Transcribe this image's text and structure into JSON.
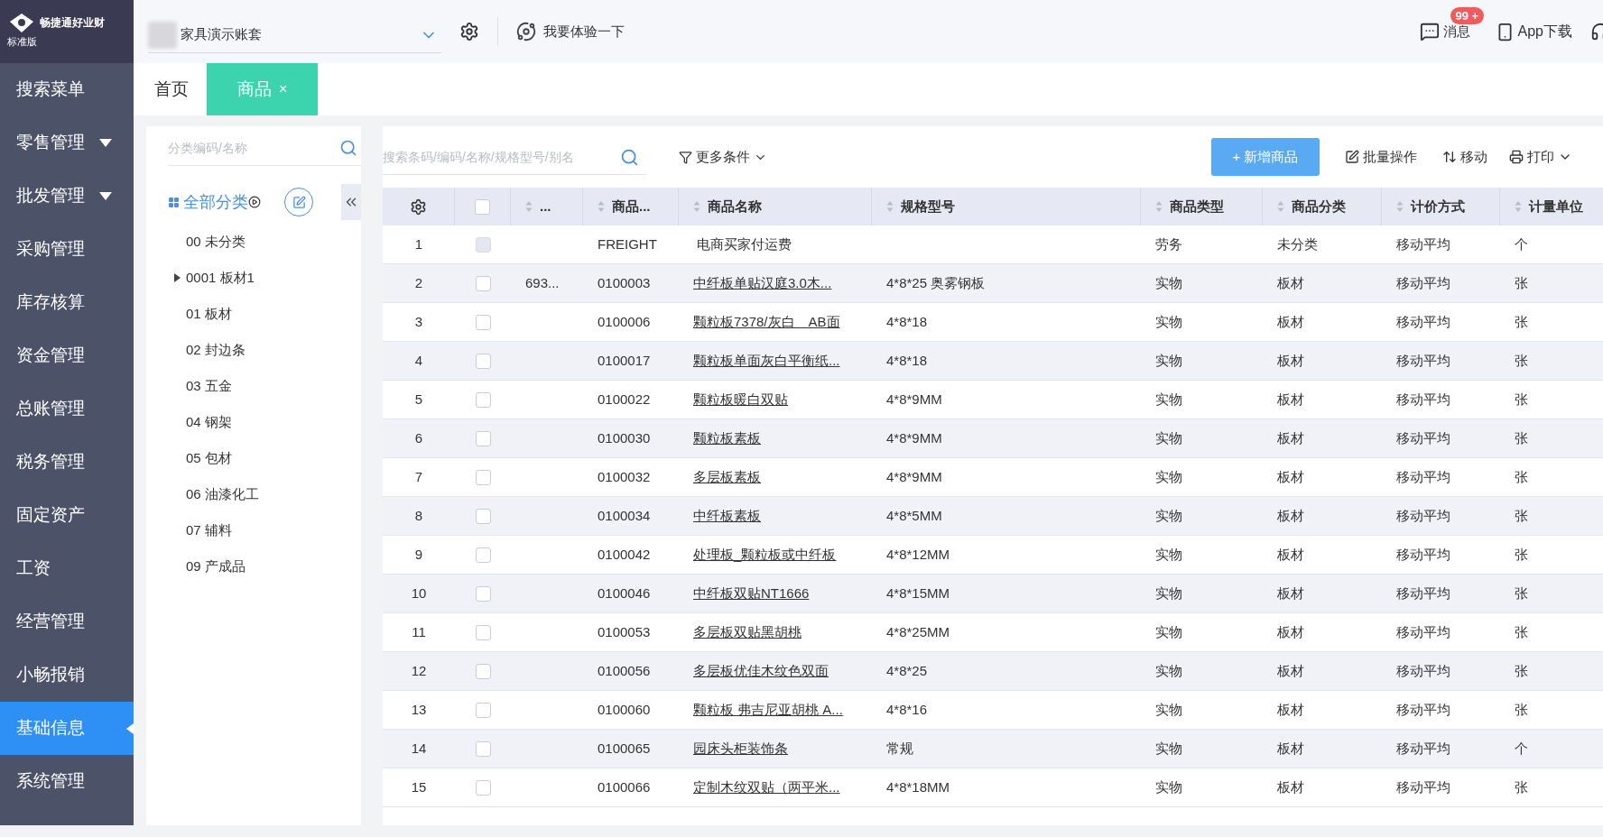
{
  "brand": {
    "name": "畅捷通好业财",
    "edition": "标准版"
  },
  "header": {
    "account": "家具演示账套",
    "try_link": "我要体验一下",
    "messages": {
      "label": "消息",
      "badge": "99 +"
    },
    "app_download": "App下载"
  },
  "sidebar": {
    "items": [
      {
        "label": "搜索菜单",
        "expandable": false,
        "selected": false
      },
      {
        "label": "零售管理",
        "expandable": true,
        "selected": false
      },
      {
        "label": "批发管理",
        "expandable": true,
        "selected": false
      },
      {
        "label": "采购管理",
        "expandable": false,
        "selected": false
      },
      {
        "label": "库存核算",
        "expandable": false,
        "selected": false
      },
      {
        "label": "资金管理",
        "expandable": false,
        "selected": false
      },
      {
        "label": "总账管理",
        "expandable": false,
        "selected": false
      },
      {
        "label": "税务管理",
        "expandable": false,
        "selected": false
      },
      {
        "label": "固定资产",
        "expandable": false,
        "selected": false
      },
      {
        "label": "工资",
        "expandable": false,
        "selected": false
      },
      {
        "label": "经营管理",
        "expandable": false,
        "selected": false
      },
      {
        "label": "小畅报销",
        "expandable": false,
        "selected": false
      },
      {
        "label": "基础信息",
        "expandable": false,
        "selected": true
      },
      {
        "label": "系统管理",
        "expandable": false,
        "selected": false
      }
    ]
  },
  "tabs": [
    {
      "label": "首页",
      "selected": false
    },
    {
      "label": "商品",
      "selected": true,
      "close": "×"
    }
  ],
  "category_panel": {
    "search_placeholder": "分类编码/名称",
    "root": "全部分类",
    "items": [
      {
        "label": "00 未分类",
        "expandable": false
      },
      {
        "label": "0001 板材1",
        "expandable": true
      },
      {
        "label": "01 板材",
        "expandable": false
      },
      {
        "label": "02 封边条",
        "expandable": false
      },
      {
        "label": "03 五金",
        "expandable": false
      },
      {
        "label": "04 钢架",
        "expandable": false
      },
      {
        "label": "05 包材",
        "expandable": false
      },
      {
        "label": "06 油漆化工",
        "expandable": false
      },
      {
        "label": "07 辅料",
        "expandable": false
      },
      {
        "label": "09 产成品",
        "expandable": false
      }
    ]
  },
  "toolbar": {
    "search_placeholder": "搜索条码/编码/名称/规格型号/别名",
    "more_filters": "更多条件",
    "add_button": "+ 新增商品",
    "batch": "批量操作",
    "move": "移动",
    "print": "打印"
  },
  "table": {
    "columns": [
      "...",
      "商品...",
      "商品名称",
      "规格型号",
      "商品类型",
      "商品分类",
      "计价方式",
      "计量单位"
    ],
    "select_all": {
      "checked": false
    },
    "rows": [
      {
        "no": "1",
        "checked": false,
        "disabled": true,
        "code": "FREIGHT",
        "name": "电商买家付运费",
        "link": false,
        "type": "劳务",
        "category": "未分类",
        "pricing": "移动平均",
        "unit": "个"
      },
      {
        "no": "2",
        "checked": false,
        "disabled": false,
        "barcode": "693...",
        "code": "0100003",
        "name": "中纤板单贴汉庭3.0木...",
        "link": true,
        "spec": "4*8*25 奥雾钢板",
        "type": "实物",
        "category": "板材",
        "pricing": "移动平均",
        "unit": "张"
      },
      {
        "no": "3",
        "checked": false,
        "disabled": false,
        "code": "0100006",
        "name": "颗粒板7378/灰白　AB面",
        "link": true,
        "spec": "4*8*18",
        "type": "实物",
        "category": "板材",
        "pricing": "移动平均",
        "unit": "张"
      },
      {
        "no": "4",
        "checked": false,
        "disabled": false,
        "code": "0100017",
        "name": "颗粒板单面灰白平衡纸...",
        "link": true,
        "spec": "4*8*18",
        "type": "实物",
        "category": "板材",
        "pricing": "移动平均",
        "unit": "张"
      },
      {
        "no": "5",
        "checked": false,
        "disabled": false,
        "code": "0100022",
        "name": "颗粒板暖白双贴",
        "link": true,
        "spec": "4*8*9MM",
        "type": "实物",
        "category": "板材",
        "pricing": "移动平均",
        "unit": "张"
      },
      {
        "no": "6",
        "checked": false,
        "disabled": false,
        "code": "0100030",
        "name": "颗粒板素板",
        "link": true,
        "spec": "4*8*9MM",
        "type": "实物",
        "category": "板材",
        "pricing": "移动平均",
        "unit": "张"
      },
      {
        "no": "7",
        "checked": false,
        "disabled": false,
        "code": "0100032",
        "name": "多层板素板",
        "link": true,
        "spec": "4*8*9MM",
        "type": "实物",
        "category": "板材",
        "pricing": "移动平均",
        "unit": "张"
      },
      {
        "no": "8",
        "checked": false,
        "disabled": false,
        "code": "0100034",
        "name": "中纤板素板",
        "link": true,
        "spec": "4*8*5MM",
        "type": "实物",
        "category": "板材",
        "pricing": "移动平均",
        "unit": "张"
      },
      {
        "no": "9",
        "checked": false,
        "disabled": false,
        "code": "0100042",
        "name": "处理板_颗粒板或中纤板",
        "link": true,
        "spec": "4*8*12MM",
        "type": "实物",
        "category": "板材",
        "pricing": "移动平均",
        "unit": "张"
      },
      {
        "no": "10",
        "checked": false,
        "disabled": false,
        "code": "0100046",
        "name": "中纤板双贴NT1666",
        "link": true,
        "spec": "4*8*15MM",
        "type": "实物",
        "category": "板材",
        "pricing": "移动平均",
        "unit": "张"
      },
      {
        "no": "11",
        "checked": false,
        "disabled": false,
        "code": "0100053",
        "name": "多层板双贴黑胡桃",
        "link": true,
        "spec": "4*8*25MM",
        "type": "实物",
        "category": "板材",
        "pricing": "移动平均",
        "unit": "张"
      },
      {
        "no": "12",
        "checked": false,
        "disabled": false,
        "code": "0100056",
        "name": "多层板优佳木纹色双面",
        "link": true,
        "spec": "4*8*25",
        "type": "实物",
        "category": "板材",
        "pricing": "移动平均",
        "unit": "张"
      },
      {
        "no": "13",
        "checked": false,
        "disabled": false,
        "code": "0100060",
        "name": "颗粒板 弗吉尼亚胡桃 A...",
        "link": true,
        "spec": "4*8*16",
        "type": "实物",
        "category": "板材",
        "pricing": "移动平均",
        "unit": "张"
      },
      {
        "no": "14",
        "checked": false,
        "disabled": false,
        "code": "0100065",
        "name": "园床头柜装饰条",
        "link": true,
        "spec": "常规",
        "type": "实物",
        "category": "板材",
        "pricing": "移动平均",
        "unit": "个"
      },
      {
        "no": "15",
        "checked": false,
        "disabled": false,
        "code": "0100066",
        "name": "定制木纹双贴（两平米...",
        "link": true,
        "spec": "4*8*18MM",
        "type": "实物",
        "category": "板材",
        "pricing": "移动平均",
        "unit": "张"
      }
    ]
  }
}
